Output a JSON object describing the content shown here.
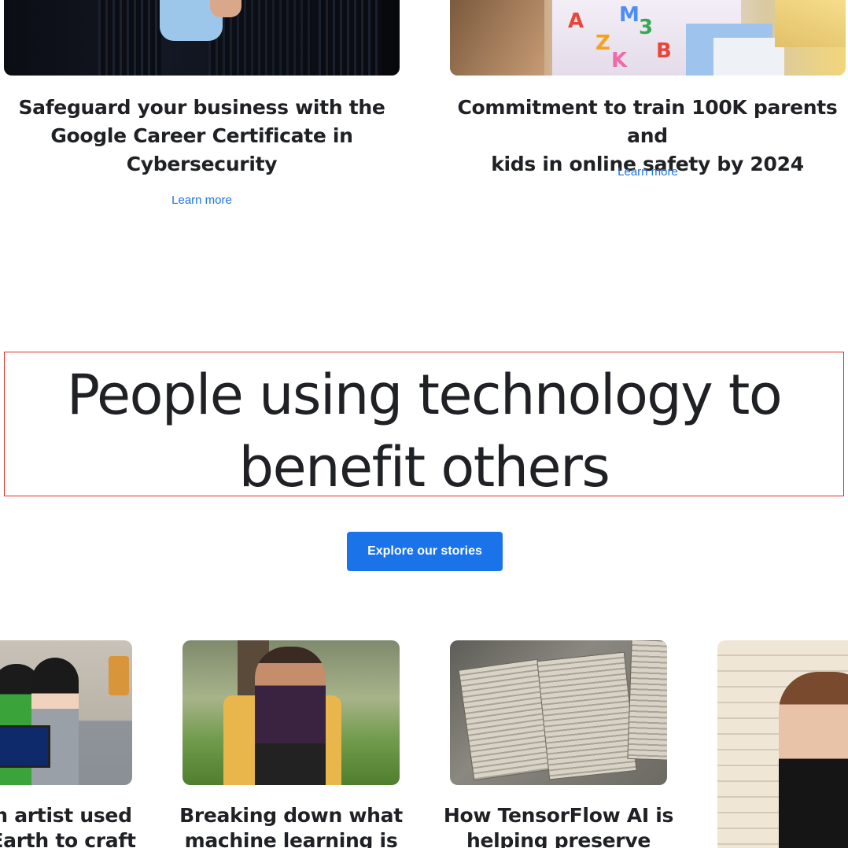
{
  "top_cards": [
    {
      "title_lines": [
        "Safeguard your business with the",
        "Google Career Certificate in",
        "Cybersecurity"
      ],
      "link": "Learn more"
    },
    {
      "title_lines": [
        "Commitment to train 100K parents and",
        "kids in online safety by 2024"
      ],
      "link": "Learn more"
    }
  ],
  "headline": {
    "line1": "People using technology to",
    "line2": "benefit others"
  },
  "cta": {
    "label": "Explore our stories"
  },
  "stories": [
    {
      "title_lines": [
        "n artist used",
        "Earth to craft"
      ]
    },
    {
      "title_lines": [
        "Breaking down what",
        "machine learning is"
      ]
    },
    {
      "title_lines": [
        "How TensorFlow AI is",
        "helping preserve"
      ]
    }
  ],
  "colors": {
    "link": "#1a73e8",
    "button": "#1a73e8",
    "text": "#202124",
    "highlight_border": "#d93025"
  }
}
